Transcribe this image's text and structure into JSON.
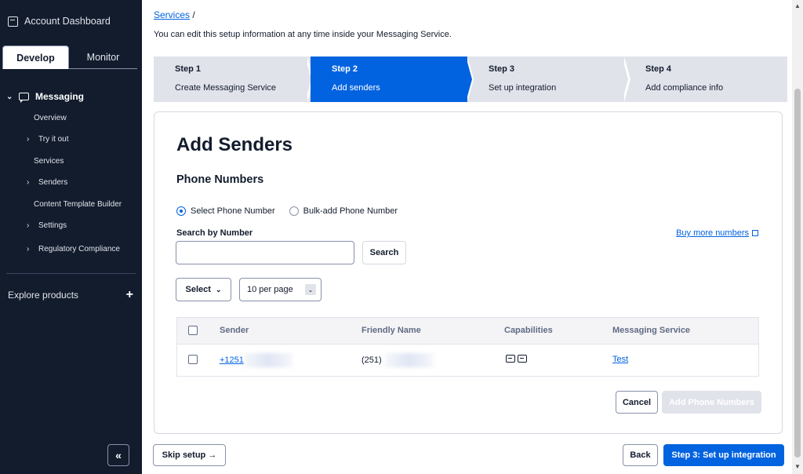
{
  "sidebar": {
    "account_label": "Account Dashboard",
    "tabs": {
      "develop": "Develop",
      "monitor": "Monitor"
    },
    "nav": {
      "messaging": "Messaging",
      "overview": "Overview",
      "try_it_out": "Try it out",
      "services": "Services",
      "senders": "Senders",
      "content_template_builder": "Content Template Builder",
      "settings": "Settings",
      "regulatory_compliance": "Regulatory Compliance"
    },
    "explore": "Explore products",
    "explore_plus": "+",
    "collapse": "«"
  },
  "breadcrumb": {
    "services": "Services",
    "sep": "/"
  },
  "intro": "You can edit this setup information at any time inside your Messaging Service.",
  "steps": [
    {
      "num": "Step 1",
      "label": "Create Messaging Service"
    },
    {
      "num": "Step 2",
      "label": "Add senders"
    },
    {
      "num": "Step 3",
      "label": "Set up integration"
    },
    {
      "num": "Step 4",
      "label": "Add compliance info"
    }
  ],
  "card": {
    "title": "Add Senders",
    "subtitle": "Phone Numbers",
    "radio_select": "Select Phone Number",
    "radio_bulk": "Bulk-add Phone Number",
    "search_label": "Search by Number",
    "search_button": "Search",
    "buy_more": "Buy more numbers",
    "select_dropdown": "Select",
    "per_page": "10 per page",
    "table": {
      "headers": [
        "Sender",
        "Friendly Name",
        "Capabilities",
        "Messaging Service"
      ],
      "rows": [
        {
          "sender": "+1251",
          "friendly_name": "(251)",
          "messaging_service": "Test"
        }
      ]
    },
    "cancel": "Cancel",
    "add_phone_numbers": "Add Phone Numbers"
  },
  "footer": {
    "skip": "Skip setup →",
    "back": "Back",
    "next": "Step 3: Set up integration"
  },
  "colors": {
    "sidebar": "#121c2d",
    "accent": "#0263e0",
    "step_inactive": "#e1e3ea"
  }
}
